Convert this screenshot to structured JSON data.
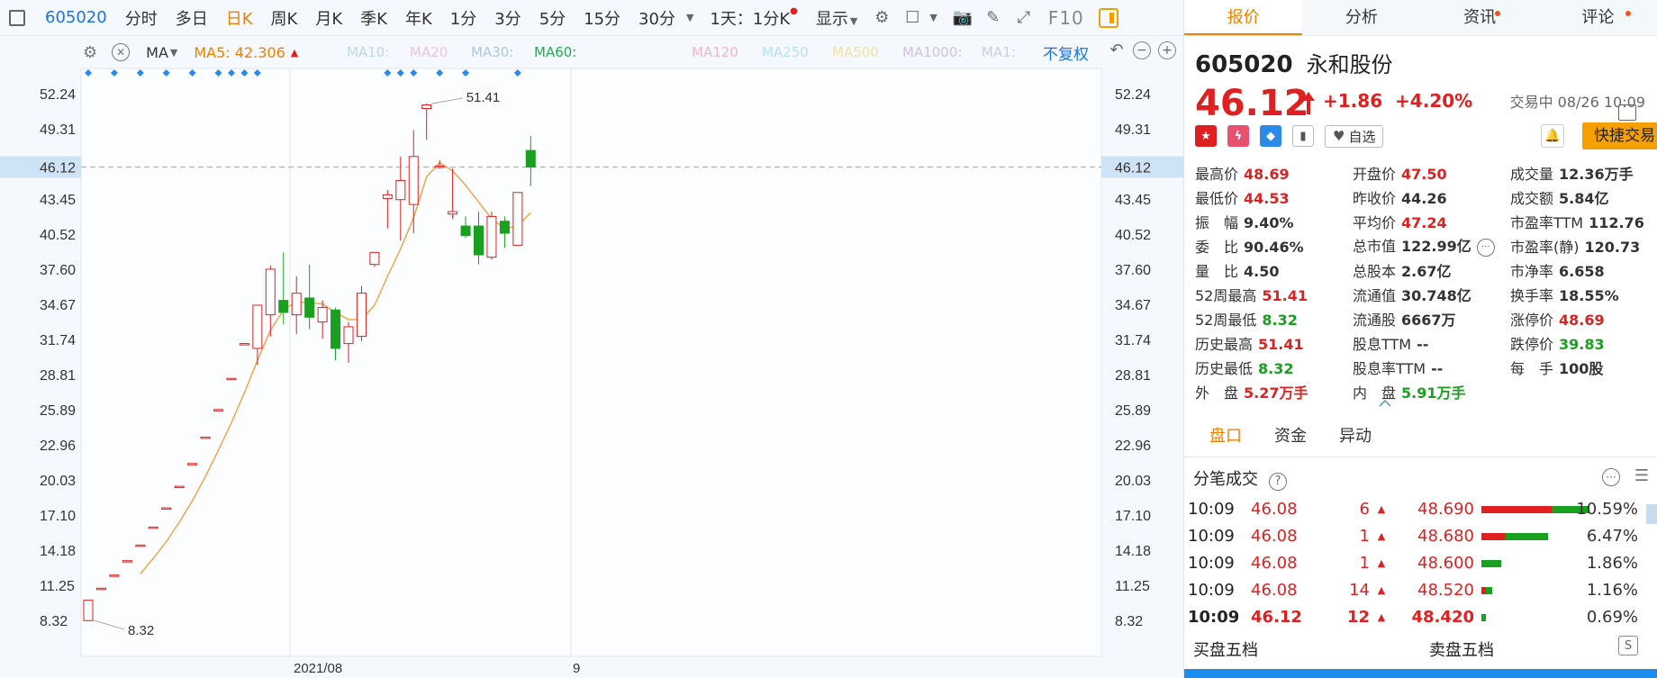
{
  "toolbar": {
    "code": "605020",
    "periods": [
      "分时",
      "多日",
      "日K",
      "周K",
      "月K",
      "季K",
      "年K",
      "1分",
      "3分",
      "5分",
      "15分",
      "30分"
    ],
    "active_period": "日K",
    "interval_label": "1天：1分K",
    "display_label": "显示",
    "f10_label": "F10"
  },
  "indicator_bar": {
    "ma_label": "MA",
    "ma5": "MA5: 42.306",
    "others": [
      "MA10:",
      "MA20",
      "MA30:",
      "MA60:",
      "MA120",
      "MA250",
      "MA500",
      "MA1000:",
      "MA1:"
    ],
    "fq_label": "不复权"
  },
  "chart_data": {
    "type": "candlestick",
    "y_ticks": [
      "52.24",
      "49.31",
      "46.12",
      "43.45",
      "40.52",
      "37.60",
      "34.67",
      "31.74",
      "28.81",
      "25.89",
      "22.96",
      "20.03",
      "17.10",
      "14.18",
      "11.25",
      "8.32"
    ],
    "x_labels": [
      "2021/08",
      "9"
    ],
    "current_price": 46.12,
    "high_label": "51.41",
    "low_label": "8.32",
    "candles": [
      {
        "o": 8.3,
        "h": 10.0,
        "l": 8.32,
        "c": 10.0
      },
      {
        "o": 11.0,
        "h": 11.0,
        "l": 11.0,
        "c": 11.0
      },
      {
        "o": 12.1,
        "h": 12.1,
        "l": 12.1,
        "c": 12.1
      },
      {
        "o": 13.3,
        "h": 13.3,
        "l": 13.3,
        "c": 13.3
      },
      {
        "o": 14.6,
        "h": 14.6,
        "l": 14.6,
        "c": 14.6
      },
      {
        "o": 16.1,
        "h": 16.1,
        "l": 16.1,
        "c": 16.1
      },
      {
        "o": 17.7,
        "h": 17.7,
        "l": 17.7,
        "c": 17.7
      },
      {
        "o": 19.5,
        "h": 19.5,
        "l": 19.5,
        "c": 19.5
      },
      {
        "o": 21.4,
        "h": 21.4,
        "l": 21.4,
        "c": 21.4
      },
      {
        "o": 23.6,
        "h": 23.6,
        "l": 23.6,
        "c": 23.6
      },
      {
        "o": 25.9,
        "h": 25.9,
        "l": 25.9,
        "c": 25.9
      },
      {
        "o": 28.5,
        "h": 28.5,
        "l": 28.5,
        "c": 28.5
      },
      {
        "o": 31.4,
        "h": 31.4,
        "l": 31.4,
        "c": 31.4
      },
      {
        "o": 31.0,
        "h": 34.6,
        "l": 29.6,
        "c": 34.6
      },
      {
        "o": 33.8,
        "h": 37.9,
        "l": 32.0,
        "c": 37.6
      },
      {
        "o": 35.0,
        "h": 39.0,
        "l": 33.0,
        "c": 34.0
      },
      {
        "o": 33.8,
        "h": 37.0,
        "l": 32.2,
        "c": 35.6
      },
      {
        "o": 35.2,
        "h": 38.0,
        "l": 32.6,
        "c": 33.6
      },
      {
        "o": 33.2,
        "h": 35.0,
        "l": 31.8,
        "c": 34.4
      },
      {
        "o": 34.2,
        "h": 34.4,
        "l": 30.0,
        "c": 31.0
      },
      {
        "o": 31.4,
        "h": 33.2,
        "l": 29.8,
        "c": 32.8
      },
      {
        "o": 32.0,
        "h": 36.2,
        "l": 31.6,
        "c": 35.6
      },
      {
        "o": 38.0,
        "h": 39.0,
        "l": 37.8,
        "c": 39.0
      },
      {
        "o": 43.5,
        "h": 44.2,
        "l": 41.0,
        "c": 43.8
      },
      {
        "o": 43.4,
        "h": 47.0,
        "l": 40.0,
        "c": 45.0
      },
      {
        "o": 43.0,
        "h": 49.2,
        "l": 40.6,
        "c": 47.0
      },
      {
        "o": 51.0,
        "h": 51.41,
        "l": 48.4,
        "c": 51.3
      },
      {
        "o": 46.1,
        "h": 46.7,
        "l": 46.0,
        "c": 46.2
      },
      {
        "o": 42.2,
        "h": 46.0,
        "l": 41.8,
        "c": 42.4
      },
      {
        "o": 41.2,
        "h": 42.0,
        "l": 40.2,
        "c": 40.4
      },
      {
        "o": 41.2,
        "h": 42.4,
        "l": 38.0,
        "c": 38.8
      },
      {
        "o": 38.6,
        "h": 42.4,
        "l": 38.4,
        "c": 42.0
      },
      {
        "o": 41.6,
        "h": 42.0,
        "l": 39.4,
        "c": 40.6
      },
      {
        "o": 39.6,
        "h": 44.0,
        "l": 39.6,
        "c": 44.0
      },
      {
        "o": 47.5,
        "h": 48.69,
        "l": 44.53,
        "c": 46.12
      }
    ],
    "ma5": [
      null,
      null,
      null,
      null,
      12.2,
      13.5,
      14.9,
      16.5,
      18.3,
      20.3,
      22.5,
      24.8,
      27.3,
      30.0,
      32.5,
      34.2,
      34.9,
      34.8,
      34.7,
      34.0,
      33.4,
      33.4,
      34.6,
      37.0,
      39.3,
      41.9,
      45.3,
      46.5,
      45.8,
      44.6,
      43.2,
      41.8,
      41.0,
      41.2,
      42.306
    ],
    "markers": [
      true,
      false,
      true,
      false,
      true,
      false,
      true,
      false,
      true,
      false,
      true,
      true,
      true,
      true,
      false,
      false,
      false,
      false,
      false,
      false,
      false,
      false,
      false,
      true,
      true,
      true,
      false,
      true,
      false,
      true,
      false,
      false,
      false,
      true,
      false
    ]
  },
  "tabs": [
    {
      "label": "报价",
      "dot": false
    },
    {
      "label": "分析",
      "dot": false
    },
    {
      "label": "资讯",
      "dot": true
    },
    {
      "label": "评论",
      "dot": true
    }
  ],
  "quote": {
    "code": "605020",
    "name": "永和股份",
    "price": "46.12",
    "change": "+1.86",
    "change_pct": "+4.20%",
    "status": "交易中 08/26 10:09",
    "watch_label": "自选",
    "fast_trade_label": "快捷交易"
  },
  "stats": [
    [
      {
        "label": "最高价",
        "value": "48.69",
        "color": "red"
      },
      {
        "label": "开盘价",
        "value": "47.50",
        "color": "red"
      },
      {
        "label": "成交量",
        "value": "12.36万手",
        "color": "dark"
      }
    ],
    [
      {
        "label": "最低价",
        "value": "44.53",
        "color": "red"
      },
      {
        "label": "昨收价",
        "value": "44.26",
        "color": "dark"
      },
      {
        "label": "成交额",
        "value": "5.84亿",
        "color": "dark"
      }
    ],
    [
      {
        "label": "振　幅",
        "value": "9.40%",
        "color": "dark"
      },
      {
        "label": "平均价",
        "value": "47.24",
        "color": "red"
      },
      {
        "label": "市盈率TTM",
        "value": "112.76",
        "color": "dark"
      }
    ],
    [
      {
        "label": "委　比",
        "value": "90.46%",
        "color": "dark"
      },
      {
        "label": "总市值",
        "value": "122.99亿",
        "color": "dark"
      },
      {
        "label": "市盈率(静)",
        "value": "120.73",
        "color": "dark"
      }
    ],
    [
      {
        "label": "量　比",
        "value": "4.50",
        "color": "dark"
      },
      {
        "label": "总股本",
        "value": "2.67亿",
        "color": "dark"
      },
      {
        "label": "市净率",
        "value": "6.658",
        "color": "dark"
      }
    ],
    [
      {
        "label": "52周最高",
        "value": "51.41",
        "color": "red"
      },
      {
        "label": "流通值",
        "value": "30.748亿",
        "color": "dark"
      },
      {
        "label": "换手率",
        "value": "18.55%",
        "color": "dark"
      }
    ],
    [
      {
        "label": "52周最低",
        "value": "8.32",
        "color": "green"
      },
      {
        "label": "流通股",
        "value": "6667万",
        "color": "dark"
      },
      {
        "label": "涨停价",
        "value": "48.69",
        "color": "red"
      }
    ],
    [
      {
        "label": "历史最高",
        "value": "51.41",
        "color": "red"
      },
      {
        "label": "股息TTM",
        "value": "--",
        "color": "dark"
      },
      {
        "label": "跌停价",
        "value": "39.83",
        "color": "green"
      }
    ],
    [
      {
        "label": "历史最低",
        "value": "8.32",
        "color": "green"
      },
      {
        "label": "股息率TTM",
        "value": "--",
        "color": "dark"
      },
      {
        "label": "每　手",
        "value": "100股",
        "color": "dark"
      }
    ],
    [
      {
        "label": "外　盘",
        "value": "5.27万手",
        "color": "red"
      },
      {
        "label": "内　盘",
        "value": "5.91万手",
        "color": "green"
      },
      null
    ]
  ],
  "subtabs": [
    "盘口",
    "资金",
    "异动"
  ],
  "ticks_header": "分笔成交",
  "ticks": [
    {
      "time": "10:09",
      "price": "46.08",
      "vol": "6",
      "bprice": "48.690",
      "pct": "10.59%",
      "red": 0.65,
      "green": 0.35
    },
    {
      "time": "10:09",
      "price": "46.08",
      "vol": "1",
      "bprice": "48.680",
      "pct": "6.47%",
      "red": 0.22,
      "green": 0.4
    },
    {
      "time": "10:09",
      "price": "46.08",
      "vol": "1",
      "bprice": "48.600",
      "pct": "1.86%",
      "red": 0.0,
      "green": 0.18
    },
    {
      "time": "10:09",
      "price": "46.08",
      "vol": "14",
      "bprice": "48.520",
      "pct": "1.16%",
      "red": 0.04,
      "green": 0.06
    },
    {
      "time": "10:09",
      "price": "46.12",
      "vol": "12",
      "bprice": "48.420",
      "pct": "0.69%",
      "red": 0.0,
      "green": 0.04
    }
  ],
  "order_book": {
    "buy_label": "买盘五档",
    "sell_label": "卖盘五档"
  },
  "colors": {
    "up": "#e02020",
    "down": "#1aa020",
    "accent": "#f08000",
    "ma5": "#f5a040"
  }
}
